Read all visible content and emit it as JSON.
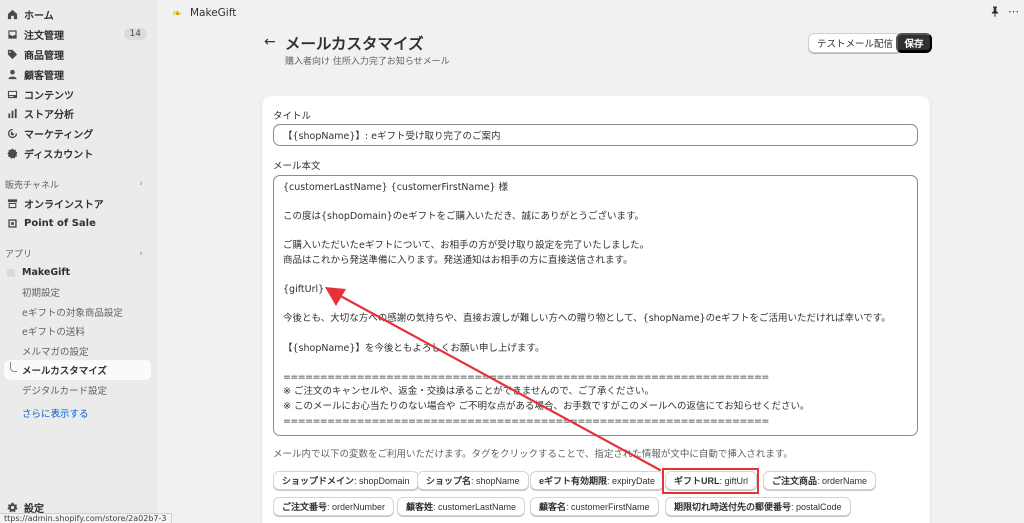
{
  "sidebar": {
    "items": [
      {
        "label": "ホーム",
        "icon": "home-icon"
      },
      {
        "label": "注文管理",
        "icon": "inbox-icon",
        "badge": "14"
      },
      {
        "label": "商品管理",
        "icon": "tag-icon"
      },
      {
        "label": "顧客管理",
        "icon": "person-icon"
      },
      {
        "label": "コンテンツ",
        "icon": "content-icon"
      },
      {
        "label": "ストア分析",
        "icon": "chart-bar-icon"
      },
      {
        "label": "マーケティング",
        "icon": "target-icon"
      },
      {
        "label": "ディスカウント",
        "icon": "discount-icon"
      }
    ],
    "sales_channels_label": "販売チャネル",
    "channels": [
      {
        "label": "オンラインストア",
        "icon": "store-icon"
      },
      {
        "label": "Point of Sale",
        "icon": "pos-icon"
      }
    ],
    "apps_label": "アプリ",
    "app": {
      "name": "MakeGift",
      "sub_items": [
        "初期設定",
        "eギフトの対象商品設定",
        "eギフトの送料",
        "メルマガの設定",
        "メールカスタマイズ",
        "デジタルカード設定"
      ],
      "selected": "メールカスタマイズ"
    },
    "more_label": "さらに表示する",
    "settings_label": "設定",
    "url_tooltip": "ttps://admin.shopify.com/store/2a02b7-3"
  },
  "topbar": {
    "app_name": "MakeGift",
    "dots": "⋯"
  },
  "header": {
    "title": "メールカスタマイズ",
    "subtitle": "購入者向け 住所入力完了お知らせメール",
    "test_button": "テストメール配信",
    "save_button": "保存"
  },
  "form": {
    "title_label": "タイトル",
    "title_value": "【{shopName}】: eギフト受け取り完了のご案内",
    "body_label": "メール本文",
    "body_lines": [
      "{customerLastName} {customerFirstName} 様",
      "",
      "この度は{shopDomain}のeギフトをご購入いただき、誠にありがとうございます。",
      "",
      "ご購入いただいたeギフトについて、お相手の方が受け取り設定を完了いたしました。",
      "商品はこれから発送準備に入ります。発送通知はお相手の方に直接送信されます。",
      "",
      "{giftUrl}",
      "",
      "今後とも、大切な方への感謝の気持ちや、直接お渡しが難しい方への贈り物として、{shopName}のeギフトをご活用いただければ幸いです。",
      "",
      "【{shopName}】を今後ともよろしくお願い申し上げます。",
      "",
      "==================================================================",
      "※ ご注文のキャンセルや、返金・交換は承ることができませんので、ご了承ください。",
      "※ このメールにお心当たりのない場合や ご不明な点がある場合、お手数ですがこのメールへの返信にてお知らせください。",
      "=================================================================="
    ],
    "help_text": "メール内で以下の変数をご利用いただけます。タグをクリックすることで、指定された情報が文中に自動で挿入されます。",
    "tags": [
      {
        "name": "ショップドメイン",
        "var": "shopDomain"
      },
      {
        "name": "ショップ名",
        "var": "shopName"
      },
      {
        "name": "eギフト有効期限",
        "var": "expiryDate"
      },
      {
        "name": "ギフトURL",
        "var": "giftUrl"
      },
      {
        "name": "ご注文商品",
        "var": "orderName"
      },
      {
        "name": "ご注文番号",
        "var": "orderNumber"
      },
      {
        "name": "顧客姓",
        "var": "customerLastName"
      },
      {
        "name": "顧客名",
        "var": "customerFirstName"
      },
      {
        "name": "期限切れ時送付先の郵便番号",
        "var": "postalCode"
      }
    ],
    "highlighted_tag": "giftUrl",
    "highlight_color": "#e53238"
  }
}
